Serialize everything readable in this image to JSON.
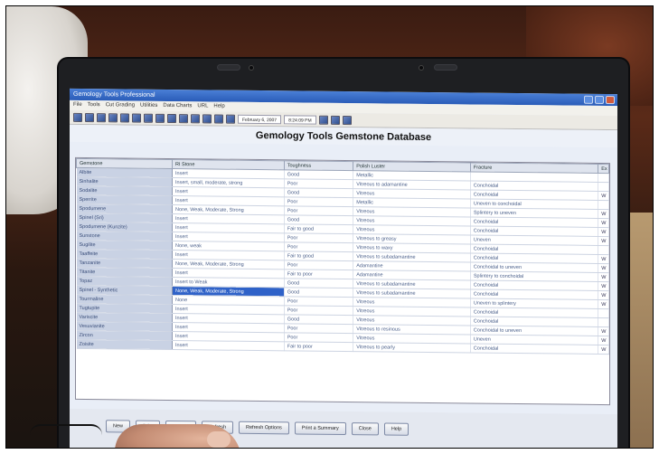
{
  "window": {
    "title": "Gemology Tools Professional"
  },
  "menubar": {
    "items": [
      "File",
      "Tools",
      "Cut Grading",
      "Utilities",
      "Data Charts",
      "URL",
      "Help"
    ]
  },
  "toolbar": {
    "date": "February 6, 2007",
    "time": "8:24:09 PM"
  },
  "database": {
    "title": "Gemology Tools Gemstone Database",
    "columns": [
      "Gemstone",
      "RI Stone",
      "Toughness",
      "Polish Luster",
      "Fracture",
      "Ex"
    ],
    "rows": [
      [
        "Albite",
        "Insert",
        "Good",
        "Metallic",
        "",
        ""
      ],
      [
        "Sinhalite",
        "Insert, small, moderate, strong",
        "Poor",
        "Vitreous to adamantine",
        "Conchoidal",
        ""
      ],
      [
        "Sodalite",
        "Insert",
        "Good",
        "Vitreous",
        "Conchoidal",
        "W"
      ],
      [
        "Sperrite",
        "Insert",
        "Poor",
        "Metallic",
        "Uneven to conchoidal",
        ""
      ],
      [
        "Spodumene",
        "None, Weak, Moderate, Strong",
        "Poor",
        "Vitreous",
        "Splintery to uneven",
        "W"
      ],
      [
        "Spinel (Sri)",
        "Insert",
        "Good",
        "Vitreous",
        "Conchoidal",
        "W"
      ],
      [
        "Spodumene (Kunzite)",
        "Insert",
        "Fair to good",
        "Vitreous",
        "Conchoidal",
        "W"
      ],
      [
        "Sunstone",
        "Insert",
        "Poor",
        "Vitreous to greasy",
        "Uneven",
        "W"
      ],
      [
        "Sugilite",
        "None, weak",
        "Poor",
        "Vitreous to waxy",
        "Conchoidal",
        ""
      ],
      [
        "Taaffeite",
        "Insert",
        "Fair to good",
        "Vitreous to subadamantine",
        "Conchoidal",
        "W"
      ],
      [
        "Tanzanite",
        "None, Weak, Moderate, Strong",
        "Poor",
        "Adamantine",
        "Conchoidal to uneven",
        "W"
      ],
      [
        "Titanite",
        "Insert",
        "Fair to poor",
        "Adamantine",
        "Splintery to conchoidal",
        "W"
      ],
      [
        "Topaz",
        "Insert to Weak",
        "Good",
        "Vitreous to subadamantine",
        "Conchoidal",
        "W"
      ],
      [
        "Spinel - Synthetic",
        "None, Weak, Moderate, Strong",
        "Good",
        "Vitreous to subadamantine",
        "Conchoidal",
        "W"
      ],
      [
        "Tourmaline",
        "None",
        "Poor",
        "Vitreous",
        "Uneven to splintery",
        "W"
      ],
      [
        "Tugtupite",
        "Insert",
        "Poor",
        "Vitreous",
        "Conchoidal",
        ""
      ],
      [
        "Variscite",
        "Insert",
        "Good",
        "Vitreous",
        "Conchoidal",
        ""
      ],
      [
        "Vesuvianite",
        "Insert",
        "Poor",
        "Vitreous to resinous",
        "Conchoidal to uneven",
        "W"
      ],
      [
        "Zircon",
        "Insert",
        "Poor",
        "Vitreous",
        "Uneven",
        "W"
      ],
      [
        "Zoisite",
        "Insert",
        "Fair to poor",
        "Vitreous to pearly",
        "Conchoidal",
        "W"
      ]
    ],
    "selected_row": 13,
    "selected_col": 1
  },
  "buttons": {
    "new": "New",
    "print": "Print",
    "search": "Search",
    "refresh": "Refresh",
    "refresh_options": "Refresh Options",
    "print_summary": "Print a Summary",
    "close": "Close",
    "help": "Help"
  },
  "colors": {
    "accent": "#2f62c8",
    "titlebar": "#2a5cb8"
  }
}
